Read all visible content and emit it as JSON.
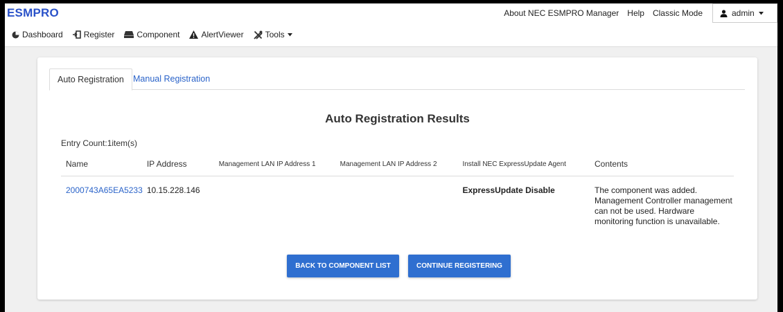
{
  "app": {
    "brand": "ESMPRO"
  },
  "topnav": {
    "about": "About NEC ESMPRO Manager",
    "help": "Help",
    "classic": "Classic Mode",
    "user": "admin"
  },
  "menu": [
    {
      "label": "Dashboard",
      "icon": "dashboard-icon"
    },
    {
      "label": "Register",
      "icon": "register-icon"
    },
    {
      "label": "Component",
      "icon": "component-icon"
    },
    {
      "label": "AlertViewer",
      "icon": "alert-icon"
    },
    {
      "label": "Tools",
      "icon": "tools-icon",
      "dropdown": true
    }
  ],
  "tabs": {
    "auto": "Auto Registration",
    "manual": "Manual Registration"
  },
  "results": {
    "title": "Auto Registration Results",
    "entry_count": "Entry Count:1item(s)",
    "columns": [
      "Name",
      "IP Address",
      "Management LAN IP Address 1",
      "Management LAN IP Address 2",
      "Install NEC ExpressUpdate Agent",
      "Contents"
    ],
    "rows": [
      {
        "name": "2000743A65EA5233",
        "ip": "10.15.228.146",
        "lan1": "",
        "lan2": "",
        "agent": "ExpressUpdate Disable",
        "contents": [
          "The component was added.",
          "Management Controller management can not be used. Hardware monitoring function is unavailable."
        ]
      }
    ]
  },
  "buttons": {
    "back": "BACK TO COMPONENT LIST",
    "continue": "CONTINUE REGISTERING"
  },
  "colors": {
    "brand": "#2a52c9",
    "link": "#2a63c9",
    "button": "#2f6fd0"
  }
}
